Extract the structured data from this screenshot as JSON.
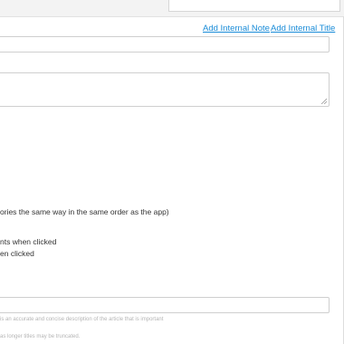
{
  "links": {
    "add_internal_note": "Add Internal Note",
    "add_internal_title": "Add Internal Title"
  },
  "options": {
    "order_text": "ories the same way in the same order as the app)",
    "clicked_1": "nts when clicked",
    "clicked_2": "en clicked"
  },
  "hints": {
    "description": "is an accurate and concise description of the article that is important",
    "truncation": "as longer titles may be truncated."
  },
  "colors": {
    "link": "#1a8cd8",
    "border": "#cfcfcf"
  }
}
